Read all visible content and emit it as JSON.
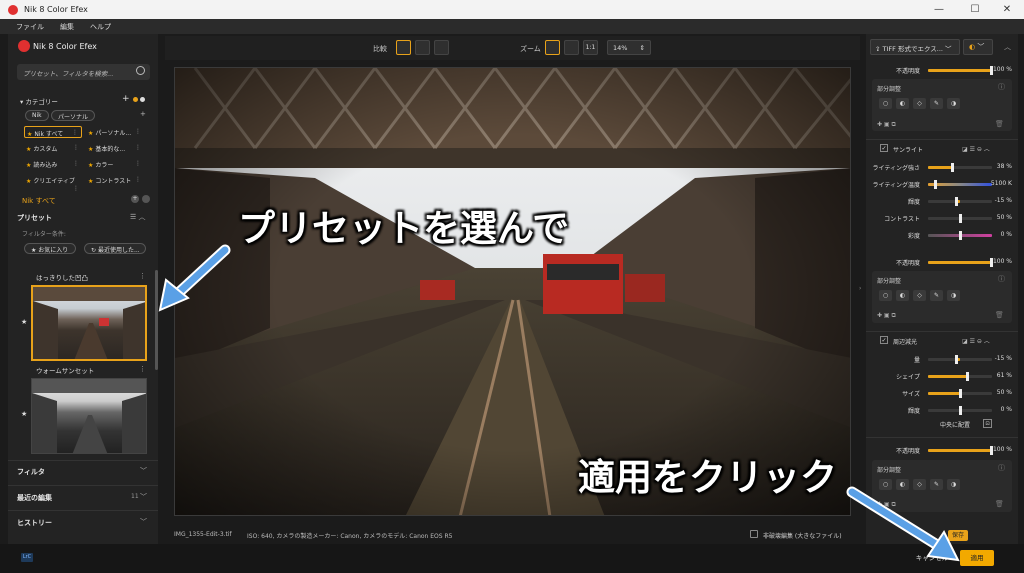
{
  "window": {
    "title": "Nik 8 Color Efex",
    "minimize_icon": "minimize-icon",
    "maximize_icon": "maximize-icon",
    "close_icon": "close-icon"
  },
  "menubar": {
    "items": [
      "ファイル",
      "編集",
      "ヘルプ"
    ]
  },
  "left_panel": {
    "app_name": "Nik 8 Color Efex",
    "search_placeholder": "プリセット、フィルタを検索...",
    "category_header": "カテゴリー",
    "category_tabs": [
      "Nik",
      "パーソナル"
    ],
    "categories": [
      "Nik すべて",
      "パーソナル...",
      "カスタム",
      "基本的な...",
      "読み込み",
      "カラー",
      "クリエイティブ",
      "コントラスト"
    ],
    "nik_all_label": "Nik すべて",
    "preset_header": "プリセット",
    "filter_condition": "フィルター条件:",
    "filter_buttons": [
      "お気に入り",
      "最近使用した..."
    ],
    "preset_names": [
      "はっきりした凹凸",
      "ウォームサンセット"
    ],
    "sections": [
      {
        "label": "フィルタ",
        "count": ""
      },
      {
        "label": "最近の編集",
        "count": "11"
      },
      {
        "label": "ヒストリー",
        "count": ""
      }
    ]
  },
  "toolbar": {
    "compare_label": "比較",
    "zoom_label": "ズーム",
    "zoom_one_to_one": "1:1",
    "zoom_value": "14%"
  },
  "status": {
    "filename": "IMG_1355-Edit-3.tif",
    "meta": "ISO: 640, カメラの製造メーカー: Canon, カメラのモデル: Canon EOS R5",
    "nondestructive_label": "非破壊編集 (大きなファイル)"
  },
  "right_panel": {
    "export_label": "TIFF 形式でエクス...",
    "opacity_label": "不透明度",
    "partial_adjust_label": "部分調整",
    "filters": [
      {
        "name": "サンライト",
        "params": [
          {
            "label": "ライティング強さ",
            "value": "38 %",
            "level": 0.38
          },
          {
            "label": "ライティング温度",
            "value": "5100 K",
            "level": 0.1
          },
          {
            "label": "輝度",
            "value": "-15 %",
            "level": 0.42
          },
          {
            "label": "コントラスト",
            "value": "50 %",
            "level": 0.5
          },
          {
            "label": "彩度",
            "value": "0 %",
            "level": 0.5
          }
        ]
      },
      {
        "name": "周辺減光",
        "params": [
          {
            "label": "量",
            "value": "-15 %",
            "level": 0.42
          },
          {
            "label": "シェイプ",
            "value": "61 %",
            "level": 0.61
          },
          {
            "label": "サイズ",
            "value": "50 %",
            "level": 0.5
          },
          {
            "label": "輝度",
            "value": "0 %",
            "level": 0.5
          }
        ],
        "center_label": "中央に配置"
      }
    ],
    "opacity_values": [
      "100 %",
      "100 %",
      "100 %"
    ],
    "save_label": "保存"
  },
  "bottom": {
    "cancel_label": "キャンセル",
    "apply_label": "適用",
    "lr_badge": "LrC"
  },
  "annotations": {
    "select_preset": "プリセットを選んで",
    "click_apply": "適用をクリック"
  },
  "colors": {
    "accent": "#e8a21a",
    "arrow": "#5aa0e6",
    "apply_button": "#f2a900"
  }
}
